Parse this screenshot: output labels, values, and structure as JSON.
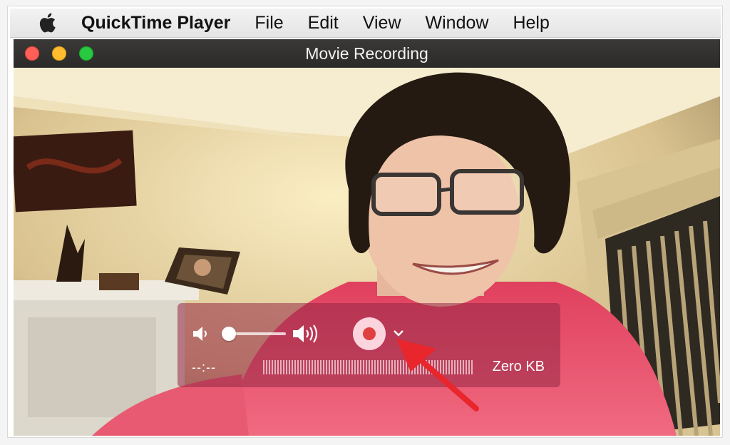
{
  "menubar": {
    "app_name": "QuickTime Player",
    "items": [
      "File",
      "Edit",
      "View",
      "Window",
      "Help"
    ],
    "icon": "apple-icon"
  },
  "window": {
    "title": "Movie Recording",
    "controls": [
      "close",
      "minimize",
      "zoom"
    ]
  },
  "hud": {
    "time": "--:--",
    "file_size": "Zero KB",
    "volume_level": 0.05,
    "icons": [
      "volume-low-icon",
      "volume-high-icon",
      "record-icon",
      "chevron-down-icon"
    ]
  },
  "colors": {
    "close": "#ff5f57",
    "minimize": "#febc2e",
    "zoom": "#28c840",
    "record": "#e0413e",
    "annotation_arrow": "#e8262c"
  }
}
